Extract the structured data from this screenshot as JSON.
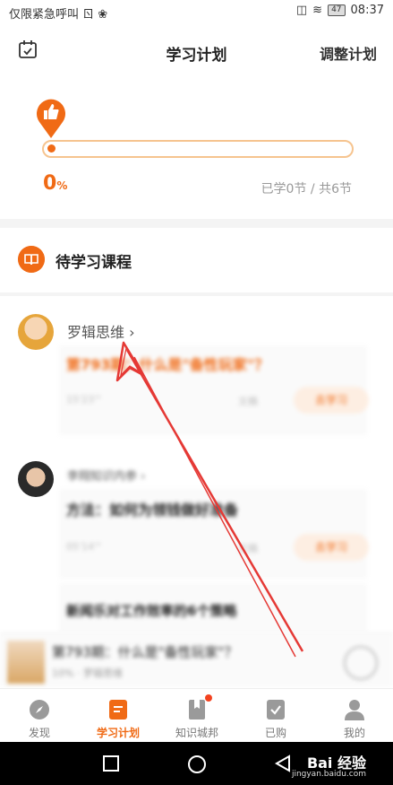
{
  "status_bar": {
    "carrier": "仅限紧急呼叫 ㄖ ❀",
    "time": "08:37",
    "battery": "47"
  },
  "header": {
    "title": "学习计划",
    "adjust_label": "调整计划"
  },
  "progress": {
    "percent": "0",
    "percent_unit": "%",
    "learned_text": "已学0节 / 共6节",
    "fraction": 0
  },
  "section": {
    "title": "待学习课程"
  },
  "courses": [
    {
      "author": "罗辑思维 ›",
      "title": "第793期：什么是\"备性玩家\"？",
      "meta_left": "15'23'\"",
      "meta_right": "文稿",
      "action": "去学习"
    },
    {
      "author": "李翔知识内参 ›",
      "title": "方法：如何为领钱做好准备",
      "meta_left": "05'14'\"",
      "meta_right": "文稿",
      "action": "去学习"
    }
  ],
  "extra_item": {
    "title": "新闻乐对工作效率的6个策略"
  },
  "player": {
    "title": "第793期：什么是\"备性玩家\"？",
    "subtitle": "10% · 罗辑思维"
  },
  "tabs": [
    {
      "label": "发现"
    },
    {
      "label": "学习计划"
    },
    {
      "label": "知识城邦"
    },
    {
      "label": "已购"
    },
    {
      "label": "我的"
    }
  ],
  "watermark": {
    "brand": "Bai 经验",
    "url": "jingyan.baidu.com"
  },
  "colors": {
    "accent": "#f06a15",
    "progress_border": "#f6c48f",
    "annotation": "#e53935"
  }
}
